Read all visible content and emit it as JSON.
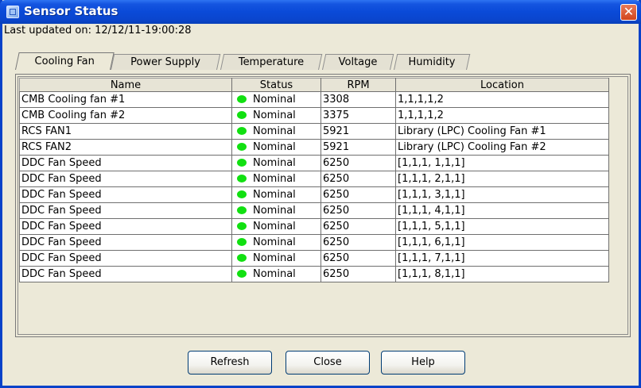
{
  "window": {
    "title": "Sensor Status",
    "close_glyph": "✕"
  },
  "last_updated": "Last updated on: 12/12/11-19:00:28",
  "tabs": [
    {
      "label": "Cooling Fan",
      "active": true
    },
    {
      "label": "Power Supply",
      "active": false
    },
    {
      "label": "Temperature",
      "active": false
    },
    {
      "label": "Voltage",
      "active": false
    },
    {
      "label": "Humidity",
      "active": false
    }
  ],
  "table": {
    "columns": [
      "Name",
      "Status",
      "RPM",
      "Location"
    ],
    "rows": [
      {
        "name": "CMB Cooling fan #1",
        "status": "Nominal",
        "rpm": "3308",
        "location": "1,1,1,1,2"
      },
      {
        "name": "CMB Cooling fan #2",
        "status": "Nominal",
        "rpm": "3375",
        "location": "1,1,1,1,2"
      },
      {
        "name": "RCS FAN1",
        "status": "Nominal",
        "rpm": "5921",
        "location": "Library (LPC) Cooling Fan #1"
      },
      {
        "name": "RCS FAN2",
        "status": "Nominal",
        "rpm": "5921",
        "location": "Library (LPC) Cooling Fan #2"
      },
      {
        "name": "DDC Fan Speed",
        "status": "Nominal",
        "rpm": "6250",
        "location": "[1,1,1, 1,1,1]"
      },
      {
        "name": "DDC Fan Speed",
        "status": "Nominal",
        "rpm": "6250",
        "location": "[1,1,1, 2,1,1]"
      },
      {
        "name": "DDC Fan Speed",
        "status": "Nominal",
        "rpm": "6250",
        "location": "[1,1,1, 3,1,1]"
      },
      {
        "name": "DDC Fan Speed",
        "status": "Nominal",
        "rpm": "6250",
        "location": "[1,1,1, 4,1,1]"
      },
      {
        "name": "DDC Fan Speed",
        "status": "Nominal",
        "rpm": "6250",
        "location": "[1,1,1, 5,1,1]"
      },
      {
        "name": "DDC Fan Speed",
        "status": "Nominal",
        "rpm": "6250",
        "location": "[1,1,1, 6,1,1]"
      },
      {
        "name": "DDC Fan Speed",
        "status": "Nominal",
        "rpm": "6250",
        "location": "[1,1,1, 7,1,1]"
      },
      {
        "name": "DDC Fan Speed",
        "status": "Nominal",
        "rpm": "6250",
        "location": "[1,1,1, 8,1,1]"
      }
    ]
  },
  "status_color": "#11e011",
  "buttons": {
    "refresh": "Refresh",
    "close": "Close",
    "help": "Help"
  }
}
